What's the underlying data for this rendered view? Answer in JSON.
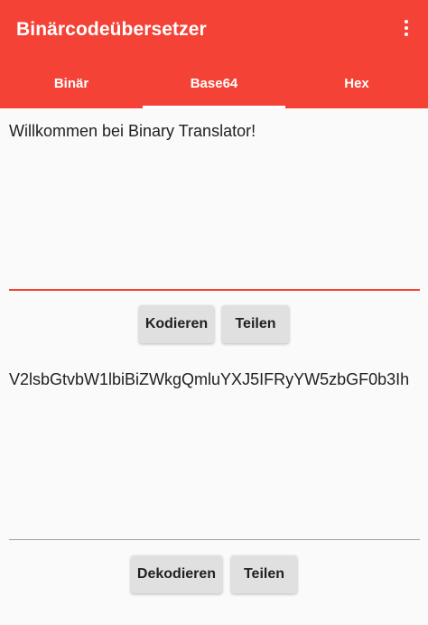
{
  "app": {
    "title": "Binärcodeübersetzer",
    "accent_color": "#f44336",
    "overflow_icon": "more-vert-icon"
  },
  "tabs": [
    {
      "label": "Binär",
      "selected": false
    },
    {
      "label": "Base64",
      "selected": true
    },
    {
      "label": "Hex",
      "selected": false
    }
  ],
  "encode_section": {
    "input_value": "Willkommen bei Binary Translator!",
    "encode_label": "Kodieren",
    "share_label": "Teilen"
  },
  "decode_section": {
    "input_value": "V2lsbGtvbW1lbiBiZWkgQmluYXJ5IFRyYW5zbGF0b3Ih",
    "decode_label": "Dekodieren",
    "share_label": "Teilen"
  }
}
